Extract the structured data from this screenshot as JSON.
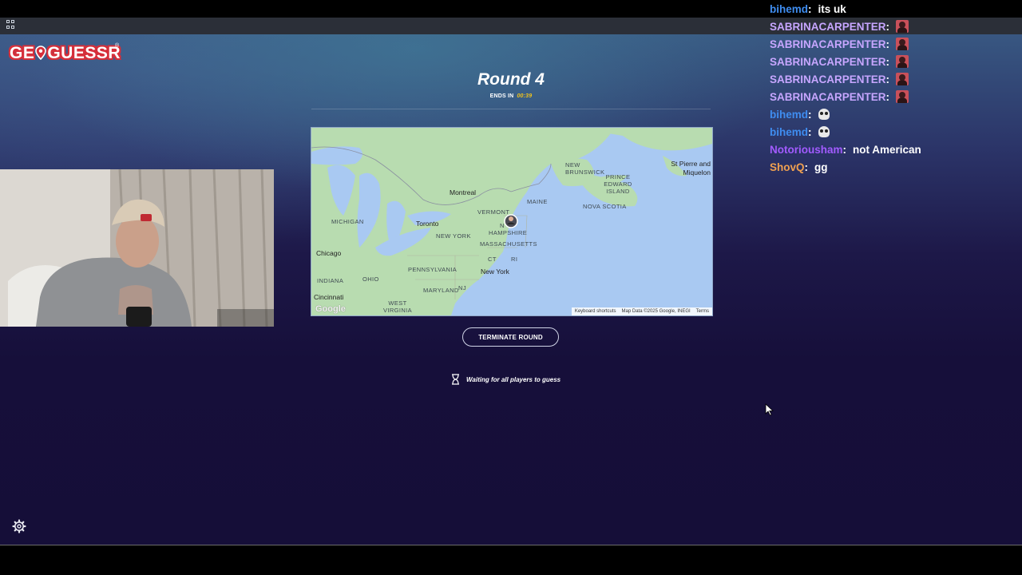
{
  "logo": {
    "text_left": "GE",
    "text_right": "GUESSR",
    "reg": "®"
  },
  "round": {
    "title": "Round 4",
    "ends_label": "ENDS IN",
    "ends_time": "00:39"
  },
  "map": {
    "labels": {
      "st_pierre": "St Pierre and Miquelon",
      "new_brunswick": "NEW BRUNSWICK",
      "pei": "PRINCE EDWARD ISLAND",
      "nova_scotia": "NOVA SCOTIA",
      "maine": "MAINE",
      "vermont": "VERMONT",
      "montreal": "Montreal",
      "new_hampshire": "HAMPSHIRE",
      "nh_prefix": "N",
      "massachusetts": "MASSACHUSETTS",
      "ct": "CT",
      "ri": "RI",
      "new_york_state": "NEW YORK",
      "new_york_city": "New York",
      "toronto": "Toronto",
      "michigan": "MICHIGAN",
      "chicago": "Chicago",
      "pennsylvania": "PENNSYLVANIA",
      "ohio": "OHIO",
      "indiana": "INDIANA",
      "maryland": "MARYLAND",
      "nj": "NJ",
      "cincinnati": "Cincinnati",
      "west_virginia": "WEST VIRGINIA",
      "google": "Google"
    },
    "footer": {
      "shortcuts": "Keyboard shortcuts",
      "data": "Map Data ©2025 Google, INEGI",
      "terms": "Terms"
    }
  },
  "actions": {
    "terminate": "TERMINATE ROUND",
    "waiting": "Waiting for all players to guess"
  },
  "chat": [
    {
      "user": "bihemd",
      "colon": ":",
      "message": "its uk",
      "color": "#3f8df0",
      "extra": "none"
    },
    {
      "user": "SABRINACARPENTER",
      "colon": ":",
      "message": "",
      "color": "#c7a6ff",
      "extra": "avatar"
    },
    {
      "user": "SABRINACARPENTER",
      "colon": ":",
      "message": "",
      "color": "#c7a6ff",
      "extra": "avatar"
    },
    {
      "user": "SABRINACARPENTER",
      "colon": ":",
      "message": "",
      "color": "#c7a6ff",
      "extra": "avatar"
    },
    {
      "user": "SABRINACARPENTER",
      "colon": ":",
      "message": "",
      "color": "#c7a6ff",
      "extra": "avatar"
    },
    {
      "user": "SABRINACARPENTER",
      "colon": ":",
      "message": "",
      "color": "#c7a6ff",
      "extra": "avatar"
    },
    {
      "user": "bihemd",
      "colon": ":",
      "message": "",
      "color": "#3f8df0",
      "extra": "skull"
    },
    {
      "user": "bihemd",
      "colon": ":",
      "message": "",
      "color": "#3f8df0",
      "extra": "skull"
    },
    {
      "user": "Notoriousham",
      "colon": ":",
      "message": "not American",
      "color": "#a25bff",
      "extra": "none"
    },
    {
      "user": "ShovQ",
      "colon": ":",
      "message": "gg",
      "color": "#f0a050",
      "extra": "none"
    }
  ],
  "icons": {
    "apps": "apps-grid-icon",
    "settings": "gear-icon",
    "timer": "hourglass-icon",
    "cursor": "mouse-cursor-icon"
  },
  "colors": {
    "accent_time": "#f5c518",
    "logo_red": "#d62f3a"
  }
}
